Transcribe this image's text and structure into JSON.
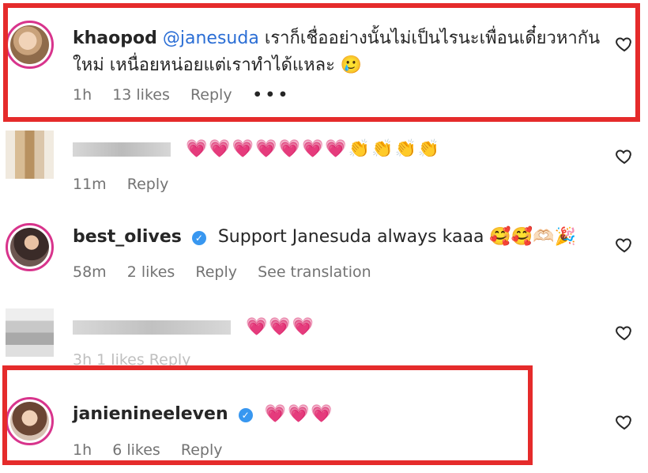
{
  "comments": [
    {
      "username": "khaopod",
      "mention": "@janesuda",
      "text_line1": "เราก็เชื่ออย่างนั้นไม่เป็นไรนะเพื่อนเดี๋ยวหากัน",
      "text_line2": "ใหม่ เหนื่อยหน่อยแต่เราทำได้แหละ 🥲",
      "time": "1h",
      "likes": "13 likes",
      "reply": "Reply",
      "more": "•••"
    },
    {
      "emoji": "💗💗💗💗💗💗💗👏👏👏👏",
      "time": "11m",
      "reply": "Reply"
    },
    {
      "username": "best_olives",
      "text": "Support Janesuda always kaaa 🥰🥰🫶🏻🎉",
      "time": "58m",
      "likes": "2 likes",
      "reply": "Reply",
      "translation": "See translation"
    },
    {
      "emoji": "💗💗💗",
      "meta_ghost": "3h   1 likes   Reply"
    },
    {
      "username": "janienineeleven",
      "emoji": "💗💗💗",
      "time": "1h",
      "likes": "6 likes",
      "reply": "Reply"
    }
  ],
  "icons": {
    "heart": "heart-icon",
    "verified": "verified-badge-icon"
  },
  "colors": {
    "highlight": "#e52b2b",
    "mention": "#2b6ed5",
    "story_ring": "#d8348c"
  }
}
